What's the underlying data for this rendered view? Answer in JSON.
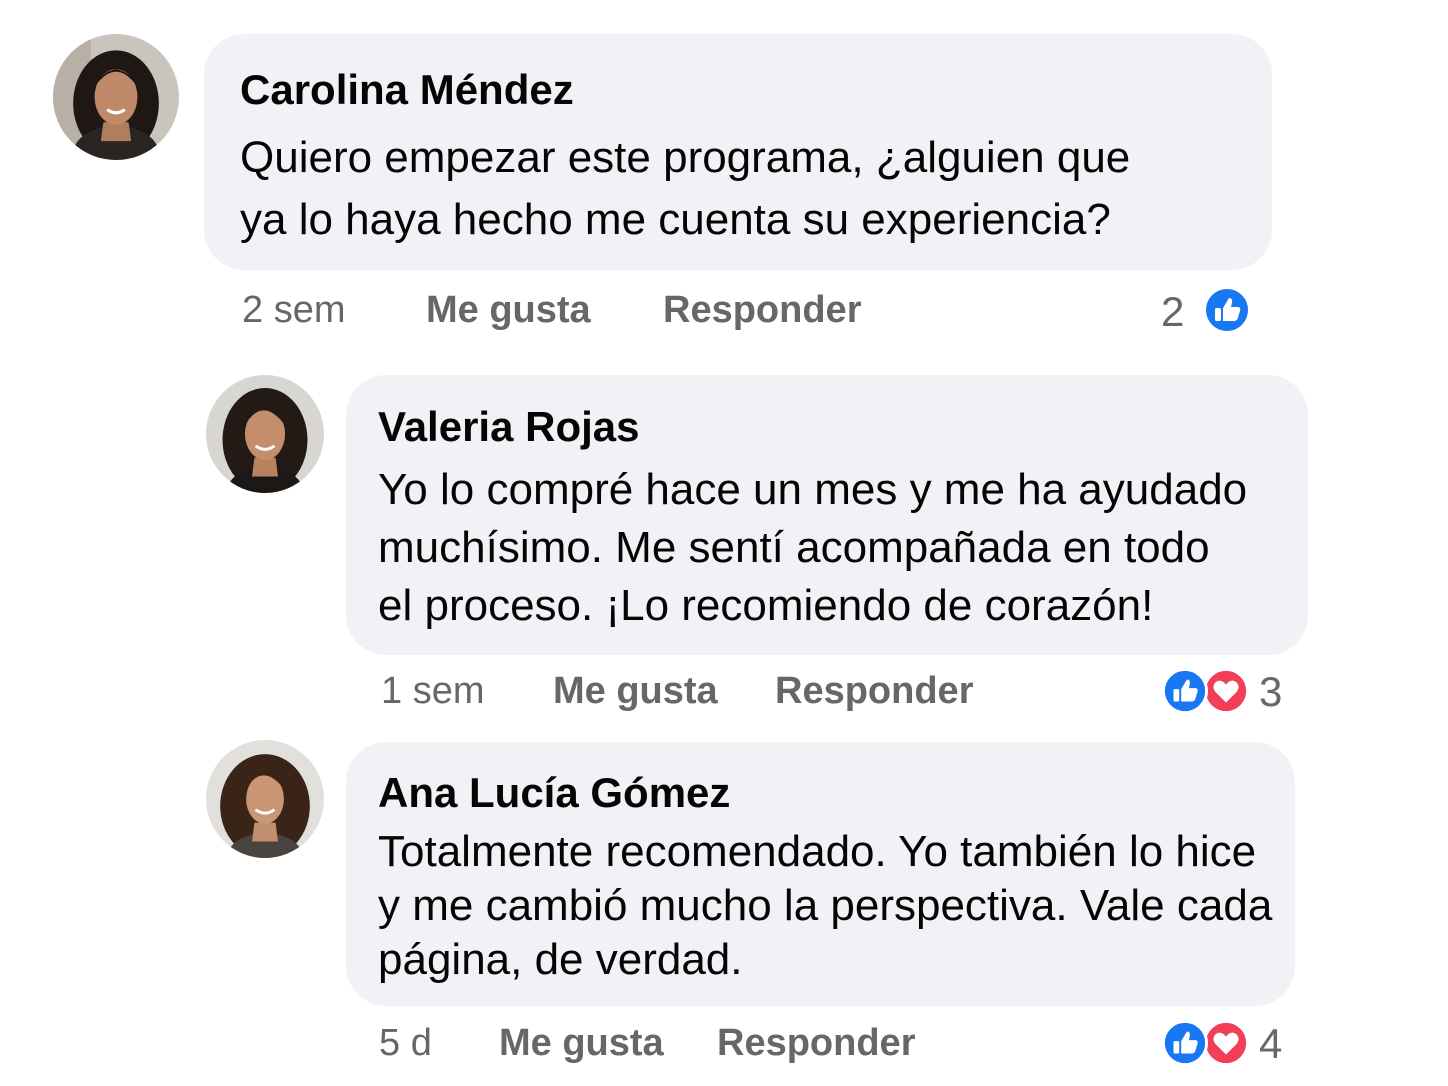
{
  "comments": [
    {
      "author": "Carolina Méndez",
      "lines": [
        "Quiero empezar este programa, ¿alguien que",
        "ya lo haya hecho me cuenta su experiencia?"
      ],
      "time": "2 sem",
      "like_label": "Me gusta",
      "reply_label": "Responder",
      "reaction_count": "2",
      "reactions": [
        "like-icon"
      ]
    },
    {
      "author": "Valeria Rojas",
      "lines": [
        "Yo lo compré hace un mes y me ha ayudado",
        "muchísimo. Me sentí acompañada en todo",
        "el proceso. ¡Lo recomiendo de corazón!"
      ],
      "time": "1 sem",
      "like_label": "Me gusta",
      "reply_label": "Responder",
      "reaction_count": "3",
      "reactions": [
        "like-icon",
        "love-icon"
      ]
    },
    {
      "author": "Ana Lucía Gómez",
      "lines": [
        "Totalmente recomendado. Yo también lo hice",
        "y me cambió mucho la perspectiva. Vale cada",
        "página, de verdad."
      ],
      "time": "5 d",
      "like_label": "Me gusta",
      "reply_label": "Responder",
      "reaction_count": "4",
      "reactions": [
        "like-icon",
        "love-icon"
      ]
    }
  ],
  "colors": {
    "bubble": "#f0f2f5",
    "meta_text": "#65676b",
    "like_blue": "#1877f2",
    "love_red": "#f33e58"
  }
}
